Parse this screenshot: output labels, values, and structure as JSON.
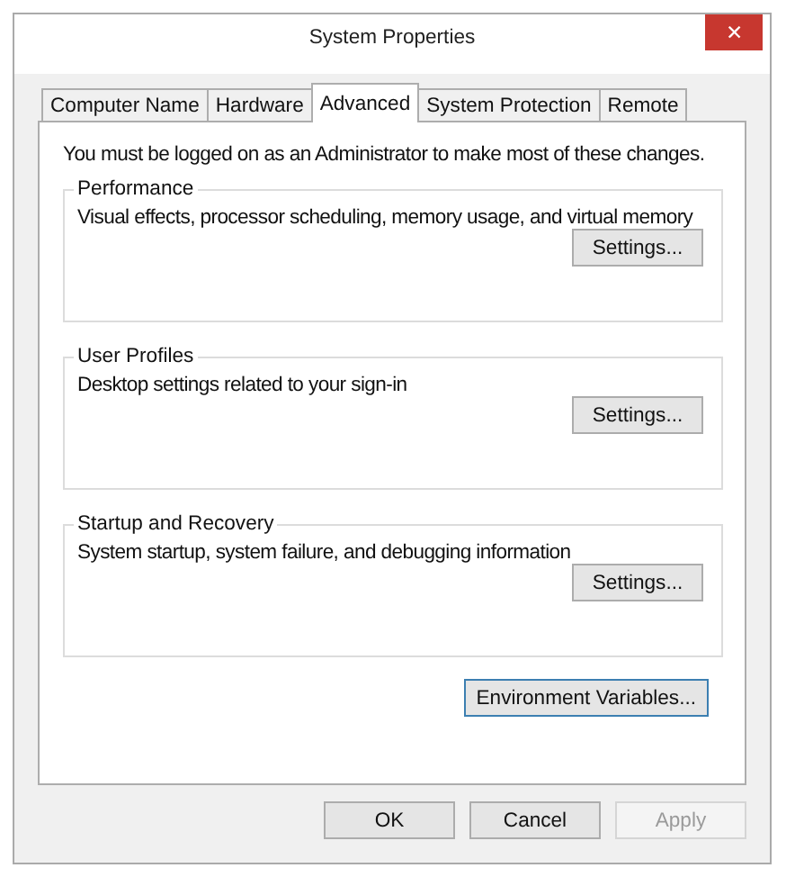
{
  "window": {
    "title": "System Properties",
    "close": "✕"
  },
  "tabs": [
    {
      "label": "Computer Name",
      "selected": false
    },
    {
      "label": "Hardware",
      "selected": false
    },
    {
      "label": "Advanced",
      "selected": true
    },
    {
      "label": "System Protection",
      "selected": false
    },
    {
      "label": "Remote",
      "selected": false
    }
  ],
  "notice": "You must be logged on as an Administrator to make most of these changes.",
  "groups": [
    {
      "title": "Performance",
      "description": "Visual effects, processor scheduling, memory usage, and virtual memory",
      "button": "Settings..."
    },
    {
      "title": "User Profiles",
      "description": "Desktop settings related to your sign-in",
      "button": "Settings..."
    },
    {
      "title": "Startup and Recovery",
      "description": "System startup, system failure, and debugging information",
      "button": "Settings..."
    }
  ],
  "environment_button": {
    "label": "Environment Variables...",
    "focused": true
  },
  "buttons": [
    {
      "label": "OK",
      "disabled": false
    },
    {
      "label": "Cancel",
      "disabled": false
    },
    {
      "label": "Apply",
      "disabled": true
    }
  ]
}
